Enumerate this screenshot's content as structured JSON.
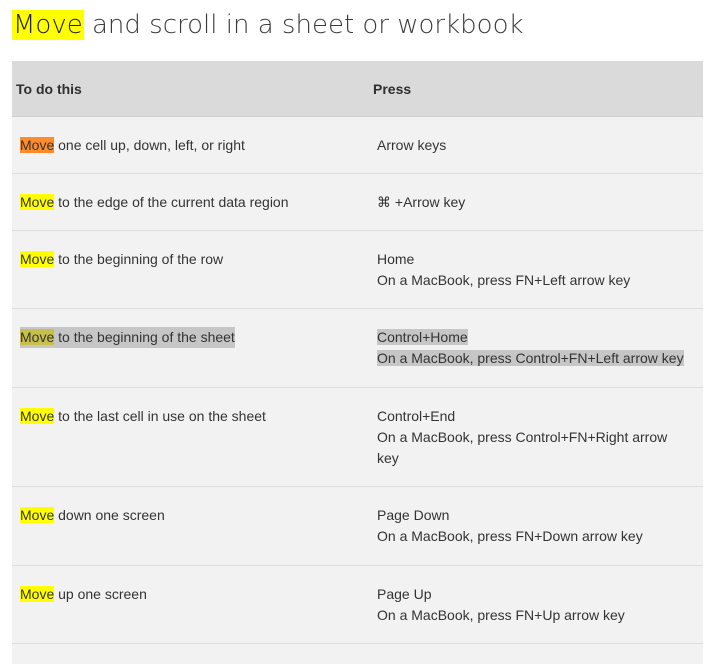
{
  "title": {
    "highlight": "Move",
    "rest": " and scroll in a sheet or workbook"
  },
  "table": {
    "headers": [
      "To do this",
      "Press"
    ],
    "rows": [
      {
        "hl": "Move",
        "action": " one cell up, down, left, or right",
        "press": [
          "Arrow keys"
        ]
      },
      {
        "hl": "Move",
        "action": " to the edge of the current data region",
        "press": [
          "⌘ +Arrow key"
        ]
      },
      {
        "hl": "Move",
        "action": " to the beginning of the row",
        "press": [
          "Home",
          "On a MacBook, press FN+Left arrow key"
        ]
      },
      {
        "hl": "Move",
        "action": " to the beginning of the sheet",
        "press": [
          "Control+Home",
          "On a MacBook, press Control+FN+Left arrow key"
        ]
      },
      {
        "hl": "Move",
        "action": " to the last cell in use on the sheet",
        "press": [
          "Control+End",
          "On a MacBook, press Control+FN+Right arrow",
          "key"
        ]
      },
      {
        "hl": "Move",
        "action": " down one screen",
        "press": [
          "Page Down",
          "On a MacBook, press FN+Down arrow key"
        ]
      },
      {
        "hl": "Move",
        "action": " up one screen",
        "press": [
          "Page Up",
          "On a MacBook, press FN+Up arrow key"
        ]
      }
    ]
  },
  "colors": {
    "highlight_yellow": "#ffff00",
    "highlight_orange": "#ff8b2b",
    "selection_gray": "#c6c6c6",
    "header_bg": "#dadada",
    "row_bg": "#f2f2f2"
  }
}
